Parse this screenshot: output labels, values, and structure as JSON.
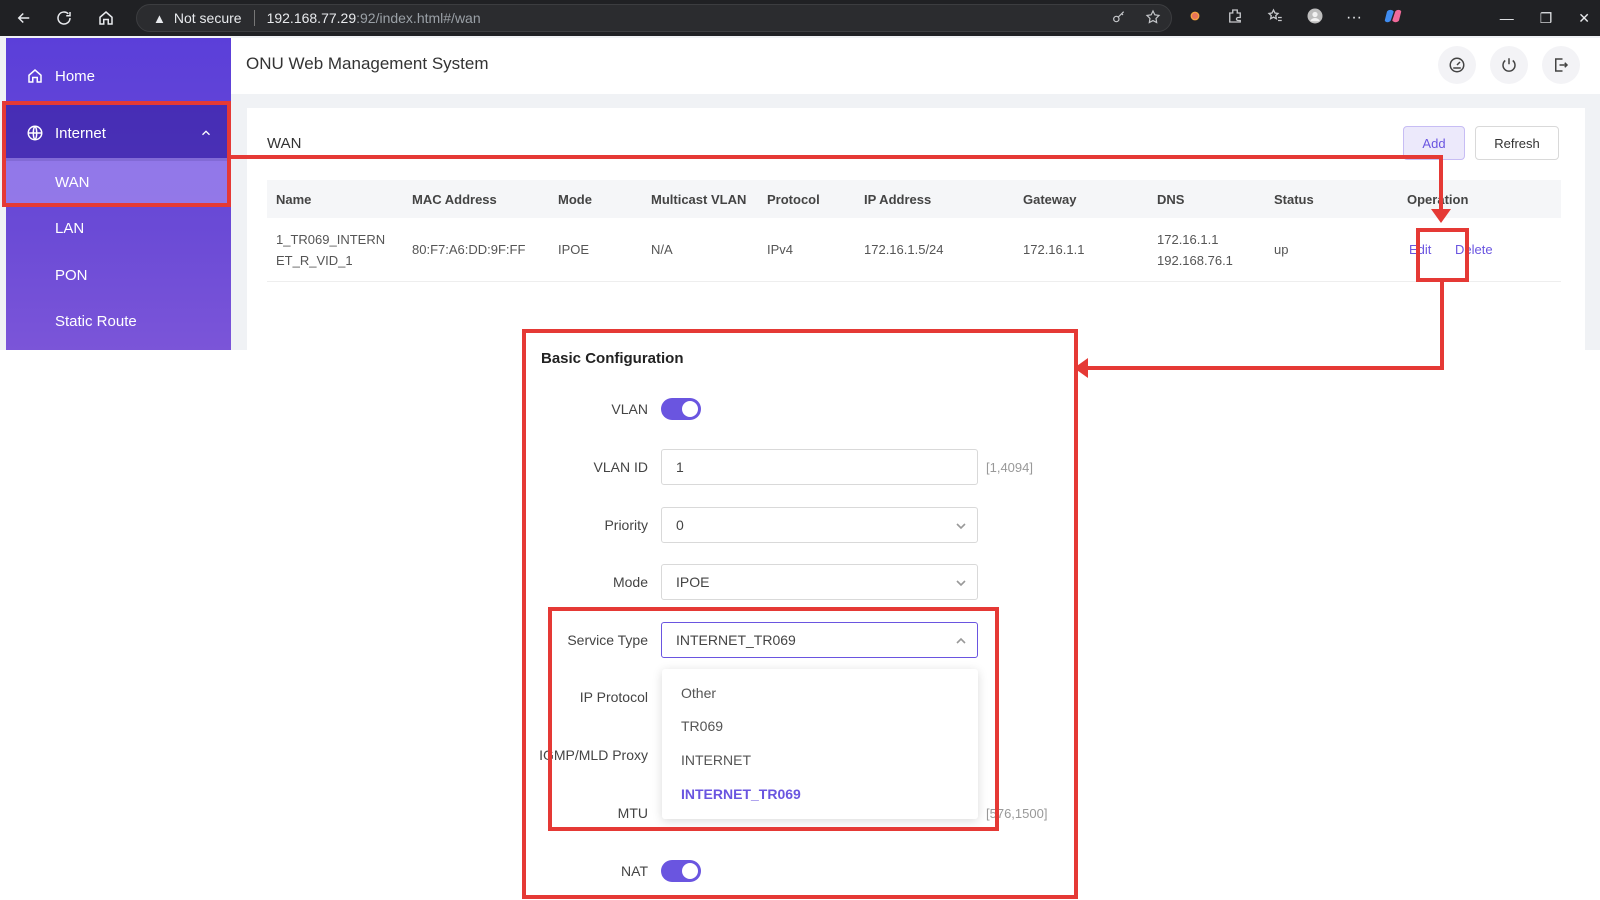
{
  "browser": {
    "not_secure": "Not secure",
    "url_host": "192.168.77.29",
    "url_path": ":92/index.html#/wan"
  },
  "app": {
    "title": "ONU Web Management System"
  },
  "sidebar": {
    "items": [
      {
        "label": "Home",
        "icon": "home-icon"
      },
      {
        "label": "Internet",
        "icon": "globe-icon"
      },
      {
        "label": "WAN"
      },
      {
        "label": "LAN"
      },
      {
        "label": "PON"
      },
      {
        "label": "Static Route"
      }
    ]
  },
  "wan": {
    "title": "WAN",
    "add_label": "Add",
    "refresh_label": "Refresh",
    "columns": [
      "Name",
      "MAC Address",
      "Mode",
      "Multicast VLAN",
      "Protocol",
      "IP Address",
      "Gateway",
      "DNS",
      "Status",
      "Operation"
    ],
    "row": {
      "name_line1": "1_TR069_INTERN",
      "name_line2": "ET_R_VID_1",
      "mac": "80:F7:A6:DD:9F:FF",
      "mode": "IPOE",
      "multicast_vlan": "N/A",
      "protocol": "IPv4",
      "ip": "172.16.1.5/24",
      "gateway": "172.16.1.1",
      "dns1": "172.16.1.1",
      "dns2": "192.168.76.1",
      "status": "up",
      "edit": "Edit",
      "delete": "Delete"
    }
  },
  "config": {
    "title": "Basic Configuration",
    "vlan_label": "VLAN",
    "vlan_on": true,
    "vlan_id_label": "VLAN ID",
    "vlan_id_value": "1",
    "vlan_id_hint": "[1,4094]",
    "priority_label": "Priority",
    "priority_value": "0",
    "mode_label": "Mode",
    "mode_value": "IPOE",
    "service_type_label": "Service Type",
    "service_type_value": "INTERNET_TR069",
    "ip_protocol_label": "IP Protocol",
    "igmp_label": "IGMP/MLD Proxy",
    "mtu_label": "MTU",
    "mtu_hint": "[576,1500]",
    "nat_label": "NAT",
    "nat_on": true,
    "service_options": [
      "Other",
      "TR069",
      "INTERNET",
      "INTERNET_TR069"
    ]
  },
  "colors": {
    "accent": "#6a55e0",
    "annotation": "#e53935"
  }
}
